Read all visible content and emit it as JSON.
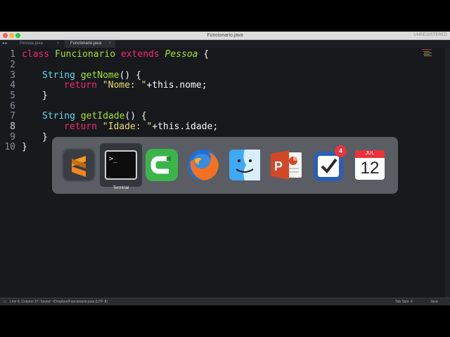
{
  "window": {
    "title": "Funcionario.java",
    "unregistered_label": "UNREGISTERED"
  },
  "tabs": [
    {
      "label": "Pessoa.java",
      "active": false
    },
    {
      "label": "Funcionario.java",
      "active": true
    }
  ],
  "editor": {
    "lines": [
      "1",
      "2",
      "3",
      "4",
      "5",
      "6",
      "7",
      "8",
      "9",
      "10"
    ],
    "code": {
      "l1": {
        "kw": "class ",
        "cls": "Funcionario ",
        "ext": "extends ",
        "sup": "Pessoa",
        "rest": " {"
      },
      "l3": {
        "type": "String ",
        "fn": "getNome",
        "rest": "() {"
      },
      "l4": {
        "kw": "return ",
        "str": "\"Nome: \"",
        "rest": "+this.nome;"
      },
      "l5": {
        "rest": "}"
      },
      "l7": {
        "type": "String ",
        "fn": "getIdade",
        "rest": "() {"
      },
      "l8": {
        "kw": "return ",
        "str": "\"Idade: \"",
        "rest": "+this.idade;"
      },
      "l9": {
        "rest": "}"
      },
      "l10": {
        "rest": "}"
      }
    }
  },
  "statusbar": {
    "left": "Line 8, Column 37; Saved ~/Dropbox/Funcionario.java (UTF-8)",
    "tab_size": "Tab Size: 4",
    "syntax": "Java"
  },
  "app_switcher": {
    "selected_label": "Terminal",
    "apps": [
      "Sublime Text",
      "Terminal",
      "Camtasia",
      "Firefox",
      "Finder",
      "PowerPoint",
      "Things",
      "Calendar"
    ],
    "things_badge": "4",
    "calendar": {
      "month": "JUL",
      "day": "12"
    }
  },
  "colors": {
    "editor_bg": "#17191d",
    "keyword": "#f92672",
    "function": "#a6e22e",
    "string": "#e6db74"
  }
}
